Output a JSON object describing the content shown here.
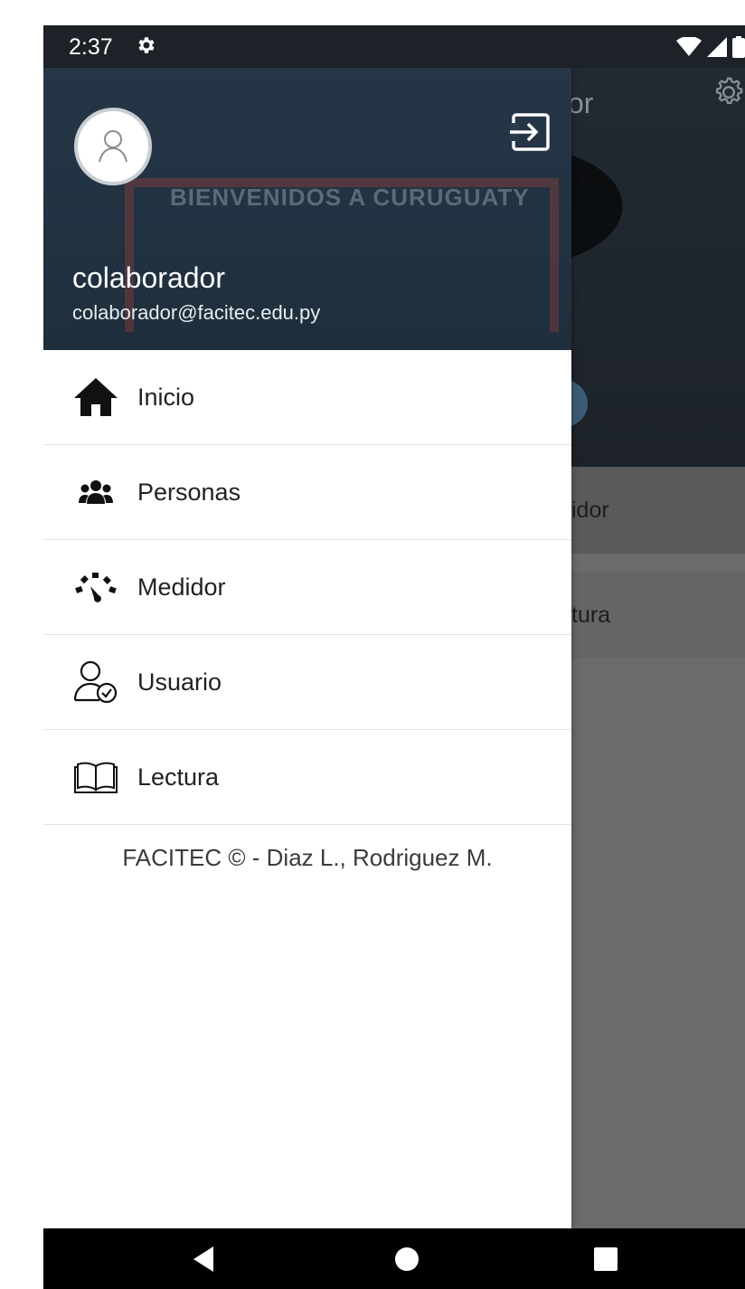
{
  "status_bar": {
    "time": "2:37",
    "icons": [
      "settings-gear-icon",
      "wifi-icon",
      "signal-icon",
      "battery-icon"
    ]
  },
  "background_app": {
    "title_fragment": "or",
    "items": [
      "idor",
      "tura"
    ]
  },
  "drawer": {
    "header": {
      "banner_text": "BIENVENIDOS A CURUGUATY",
      "user_name": "colaborador",
      "user_email": "colaborador@facitec.edu.py",
      "logout_icon": "logout-icon",
      "avatar_icon": "user-outline-icon"
    },
    "menu": [
      {
        "label": "Inicio",
        "icon": "home-icon"
      },
      {
        "label": "Personas",
        "icon": "people-group-icon"
      },
      {
        "label": "Medidor",
        "icon": "gauge-icon"
      },
      {
        "label": "Usuario",
        "icon": "user-check-icon"
      },
      {
        "label": "Lectura",
        "icon": "book-open-icon"
      }
    ],
    "footer": "FACITEC © - Diaz L., Rodriguez M."
  },
  "nav_bar": {
    "buttons": [
      "back-icon",
      "home-circle-icon",
      "recent-apps-icon"
    ]
  },
  "colors": {
    "drawer_header_bg": "#1d2d3c",
    "drawer_bg": "#ffffff",
    "scrim": "#6b6b6b",
    "nav_bar": "#000000"
  }
}
